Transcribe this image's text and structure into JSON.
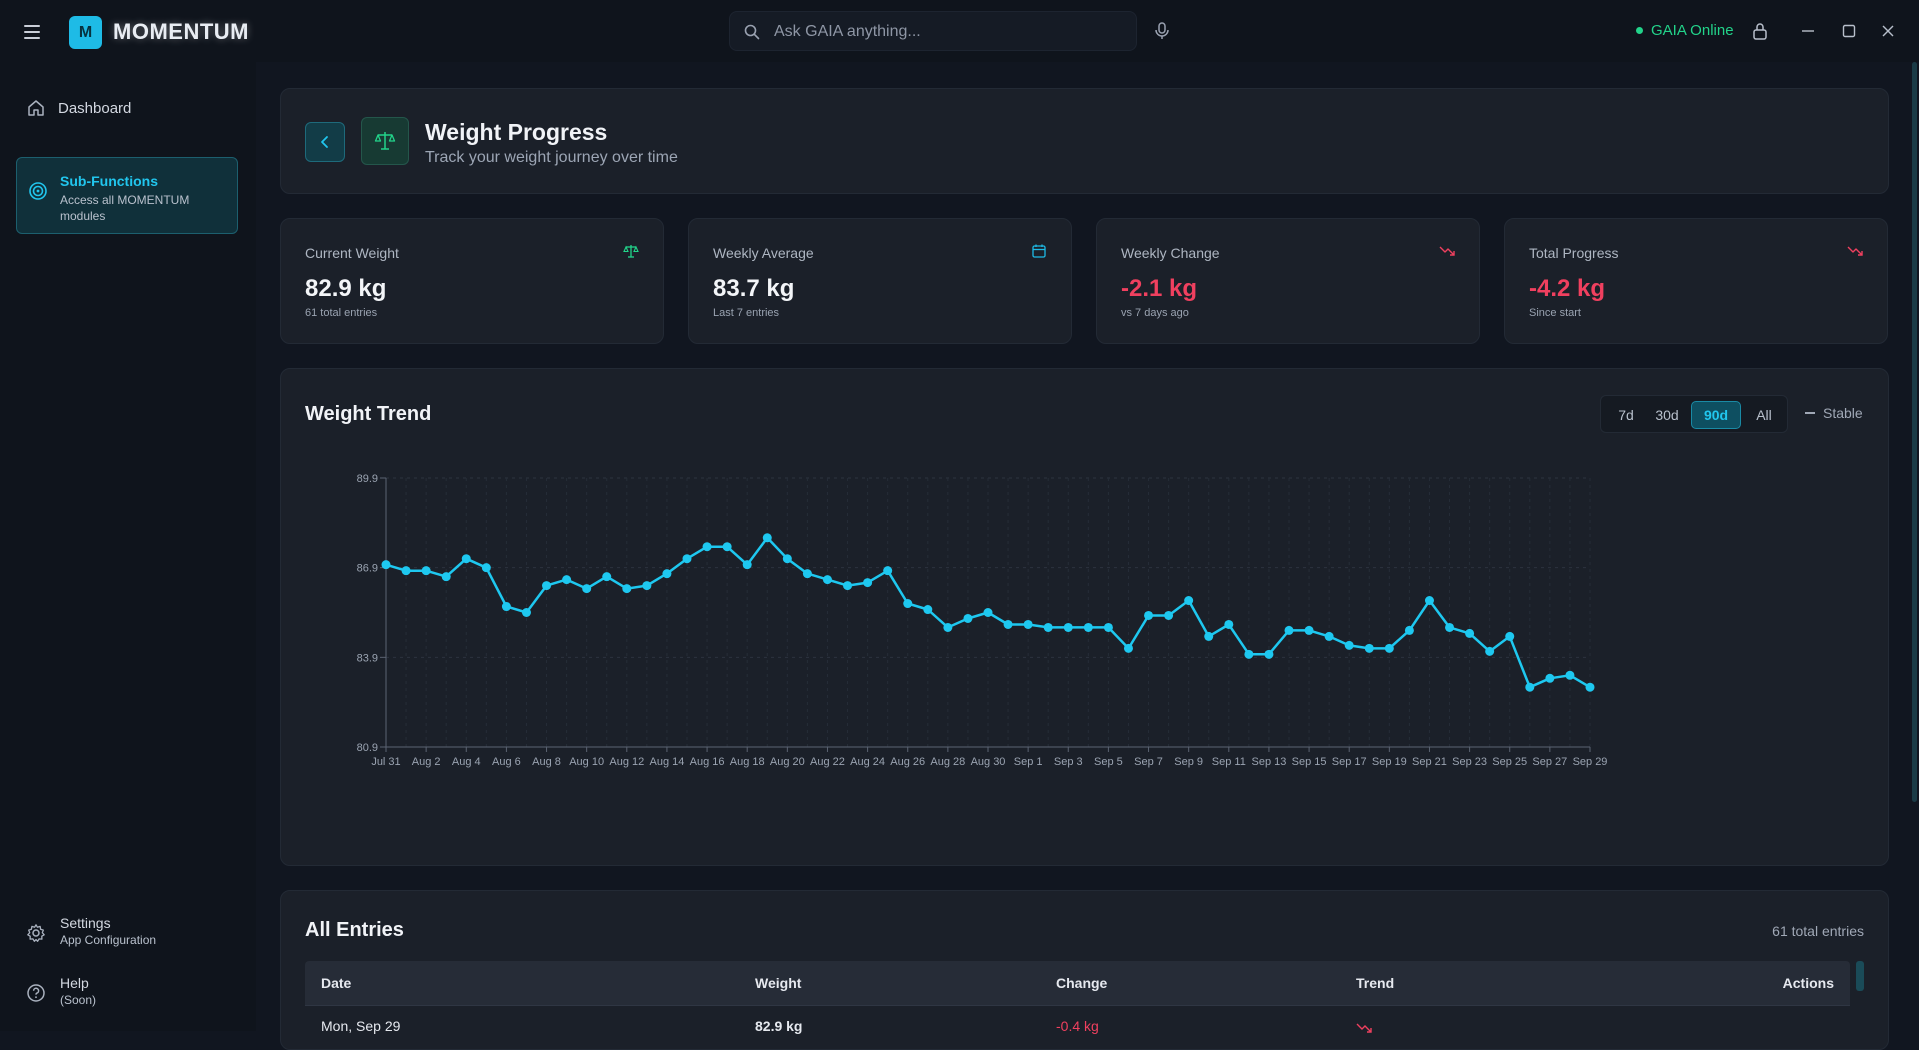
{
  "app": {
    "name": "MOMENTUM",
    "logo_letter": "M",
    "accent": "#1ebbe6"
  },
  "topbar": {
    "search_placeholder": "Ask GAIA anything...",
    "status_text": "GAIA Online",
    "status_color": "#22d38a",
    "icons": [
      "menu-icon",
      "search-icon",
      "microphone-icon",
      "lock-icon",
      "minimize-icon",
      "maximize-icon",
      "close-icon"
    ]
  },
  "sidebar": {
    "dashboard_label": "Dashboard",
    "subfunctions": {
      "title": "Sub-Functions",
      "desc": "Access all MOMENTUM modules"
    },
    "settings": {
      "title": "Settings",
      "desc": "App Configuration"
    },
    "help": {
      "title": "Help",
      "desc": "(Soon)"
    }
  },
  "header": {
    "title": "Weight Progress",
    "subtitle": "Track your weight journey over time"
  },
  "stats": [
    {
      "label": "Current Weight",
      "value": "82.9 kg",
      "sub": "61 total entries",
      "icon": "scale-icon",
      "color": "#22d38a"
    },
    {
      "label": "Weekly Average",
      "value": "83.7 kg",
      "sub": "Last 7 entries",
      "icon": "calendar-icon",
      "color": "#1ebbe6"
    },
    {
      "label": "Weekly Change",
      "value": "-2.1 kg",
      "sub": "vs 7 days ago",
      "icon": "trending-down-icon",
      "color": "#f0405f"
    },
    {
      "label": "Total Progress",
      "value": "-4.2 kg",
      "sub": "Since start",
      "icon": "trending-down-icon",
      "color": "#f0405f"
    }
  ],
  "chart_card": {
    "title": "Weight Trend",
    "ranges": [
      "7d",
      "30d",
      "90d",
      "All"
    ],
    "active_range": "90d",
    "trend_label": "Stable"
  },
  "chart_data": {
    "type": "line",
    "title": "Weight Trend",
    "xlabel": "",
    "ylabel": "",
    "ylim": [
      80.9,
      89.9
    ],
    "yticks": [
      "89.9",
      "86.9",
      "83.9",
      "80.9"
    ],
    "grid": true,
    "line_color": "#1ec8f0",
    "x_tick_labels": [
      "Jul 31",
      "Aug 2",
      "Aug 4",
      "Aug 6",
      "Aug 8",
      "Aug 10",
      "Aug 12",
      "Aug 14",
      "Aug 16",
      "Aug 18",
      "Aug 20",
      "Aug 22",
      "Aug 24",
      "Aug 26",
      "Aug 28",
      "Aug 30",
      "Sep 1",
      "Sep 3",
      "Sep 5",
      "Sep 7",
      "Sep 9",
      "Sep 11",
      "Sep 13",
      "Sep 15",
      "Sep 17",
      "Sep 19",
      "Sep 21",
      "Sep 23",
      "Sep 25",
      "Sep 27",
      "Sep 29"
    ],
    "series": [
      {
        "values": [
          87.0,
          86.8,
          86.8,
          86.6,
          87.2,
          86.9,
          85.6,
          85.4,
          86.3,
          86.5,
          86.2,
          86.6,
          86.2,
          86.3,
          86.7,
          87.2,
          87.6,
          87.6,
          87.0,
          87.9,
          87.2,
          86.7,
          86.5,
          86.3,
          86.4,
          86.8,
          85.7,
          85.5,
          84.9,
          85.2,
          85.4,
          85.0,
          85.0,
          84.9,
          84.9,
          84.9,
          84.9,
          84.2,
          85.3,
          85.3,
          85.8,
          84.6,
          85.0,
          84.0,
          84.0,
          84.8,
          84.8,
          84.6,
          84.3,
          84.2,
          84.2,
          84.8,
          85.8,
          84.9,
          84.7,
          84.1,
          84.6,
          82.9,
          83.2,
          83.3,
          82.9
        ]
      }
    ]
  },
  "entries": {
    "title": "All Entries",
    "count_text": "61 total entries",
    "columns": [
      "Date",
      "Weight",
      "Change",
      "Trend",
      "Actions"
    ],
    "rows": [
      {
        "date": "Mon, Sep 29",
        "weight": "82.9 kg",
        "change": "-0.4 kg",
        "trend": "trending-down-icon"
      }
    ]
  }
}
